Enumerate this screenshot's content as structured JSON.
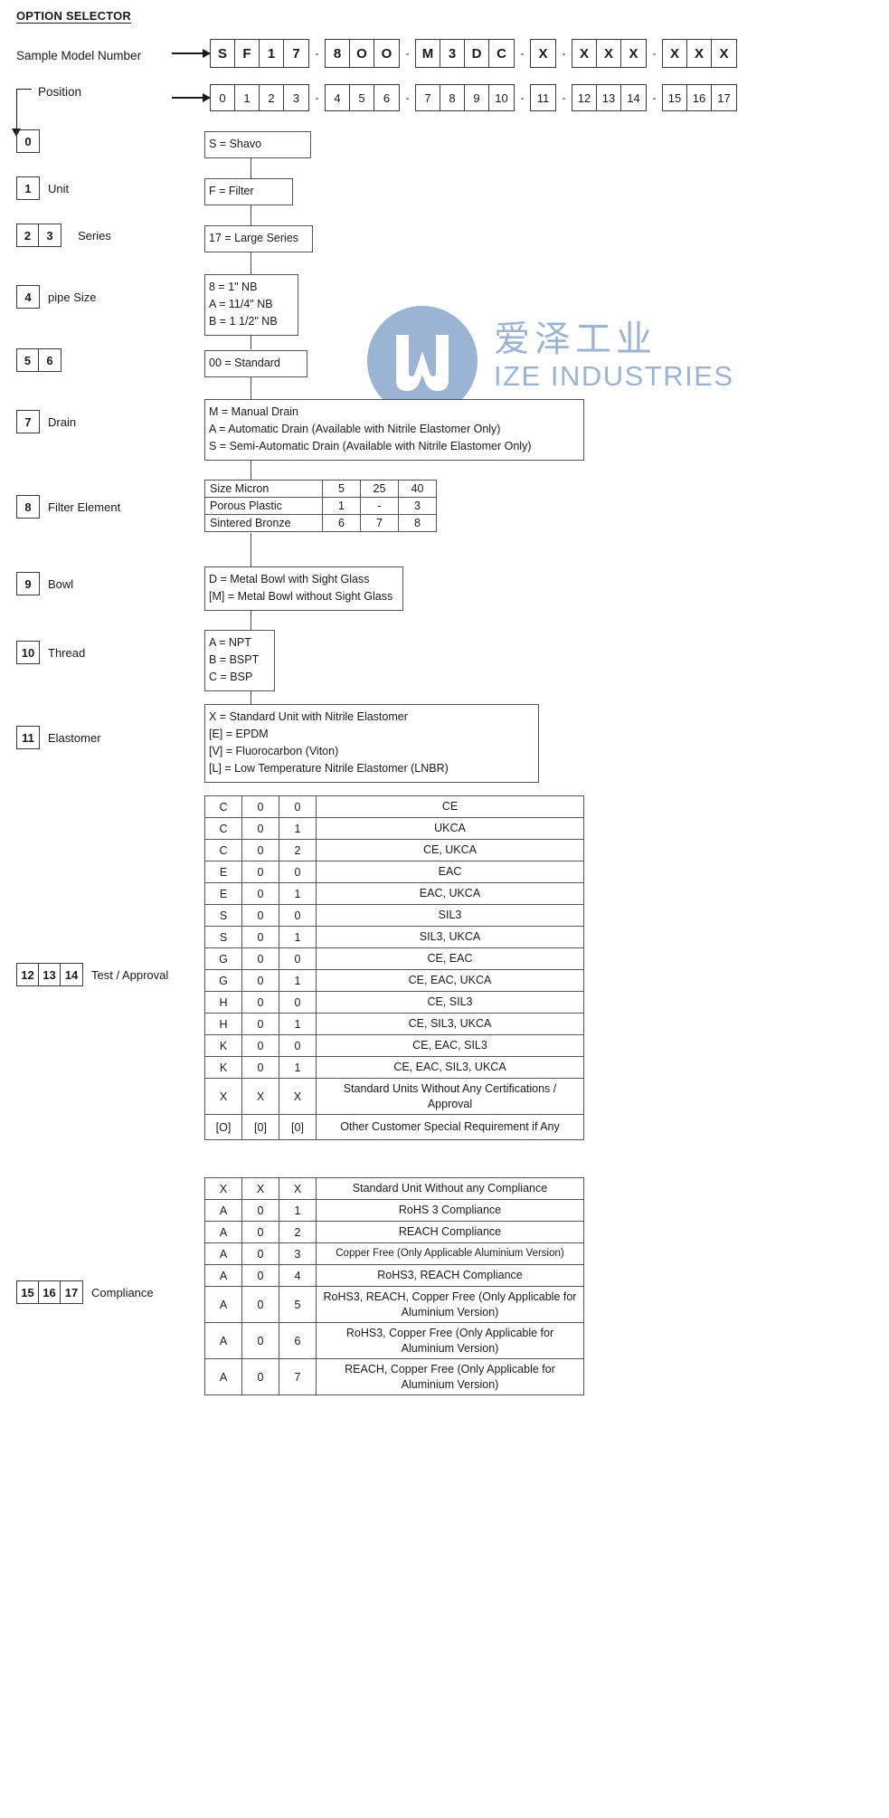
{
  "title": "OPTION SELECTOR",
  "header": {
    "sample_label": "Sample Model Number",
    "position_label": "Position",
    "model_groups": [
      [
        "S",
        "F",
        "1",
        "7"
      ],
      [
        "8",
        "O",
        "O"
      ],
      [
        "M",
        "3",
        "D",
        "C"
      ],
      [
        "X"
      ],
      [
        "X",
        "X",
        "X"
      ],
      [
        "X",
        "X",
        "X"
      ]
    ],
    "position_groups": [
      [
        "0",
        "1",
        "2",
        "3"
      ],
      [
        "4",
        "5",
        "6"
      ],
      [
        "7",
        "8",
        "9",
        "10"
      ],
      [
        "11"
      ],
      [
        "12",
        "13",
        "14"
      ],
      [
        "15",
        "16",
        "17"
      ]
    ],
    "separator": "-"
  },
  "watermark": {
    "chinese": "爱泽工业",
    "english": "IZE INDUSTRIES",
    "color": "#9bb4d4"
  },
  "sections": [
    {
      "keys": [
        "0"
      ],
      "label": "",
      "options": [
        "S = Shavo"
      ]
    },
    {
      "keys": [
        "1"
      ],
      "label": "Unit",
      "options": [
        "F = Filter"
      ]
    },
    {
      "keys": [
        "2",
        "3"
      ],
      "label": "Series",
      "options": [
        "17 = Large Series"
      ]
    },
    {
      "keys": [
        "4"
      ],
      "label": "pipe Size",
      "options": [
        "8 = 1\" NB",
        "A = 11/4\" NB",
        "B = 1 1/2\" NB"
      ]
    },
    {
      "keys": [
        "5",
        "6"
      ],
      "label": "",
      "options": [
        "00 = Standard"
      ]
    },
    {
      "keys": [
        "7"
      ],
      "label": "Drain",
      "options": [
        "M = Manual Drain",
        "A = Automatic Drain (Available with Nitrile Elastomer Only)",
        "S = Semi-Automatic Drain (Available with Nitrile Elastomer Only)"
      ]
    },
    {
      "keys": [
        "8"
      ],
      "label": "Filter Element",
      "options": []
    },
    {
      "keys": [
        "9"
      ],
      "label": "Bowl",
      "options": [
        "D = Metal Bowl with Sight Glass",
        "[M] = Metal Bowl without Sight Glass"
      ]
    },
    {
      "keys": [
        "10"
      ],
      "label": "Thread",
      "options": [
        "A = NPT",
        "B = BSPT",
        "C = BSP"
      ]
    },
    {
      "keys": [
        "11"
      ],
      "label": "Elastomer",
      "options": [
        "X = Standard Unit with Nitrile Elastomer",
        "[E] = EPDM",
        "[V] = Fluorocarbon (Viton)",
        "[L] = Low Temperature Nitrile Elastomer (LNBR)"
      ]
    },
    {
      "keys": [
        "12",
        "13",
        "14"
      ],
      "label": "Test / Approval",
      "options": []
    },
    {
      "keys": [
        "15",
        "16",
        "17"
      ],
      "label": "Compliance",
      "options": []
    }
  ],
  "filter_element_table": {
    "rows": [
      {
        "label": "Size Micron",
        "values": [
          "5",
          "25",
          "40"
        ]
      },
      {
        "label": "Porous Plastic",
        "values": [
          "1",
          "-",
          "3"
        ]
      },
      {
        "label": "Sintered Bronze",
        "values": [
          "6",
          "7",
          "8"
        ]
      }
    ]
  },
  "approval_table": {
    "rows": [
      {
        "c1": "C",
        "c2": "0",
        "c3": "0",
        "desc": "CE"
      },
      {
        "c1": "C",
        "c2": "0",
        "c3": "1",
        "desc": "UKCA"
      },
      {
        "c1": "C",
        "c2": "0",
        "c3": "2",
        "desc": "CE, UKCA"
      },
      {
        "c1": "E",
        "c2": "0",
        "c3": "0",
        "desc": "EAC"
      },
      {
        "c1": "E",
        "c2": "0",
        "c3": "1",
        "desc": "EAC, UKCA"
      },
      {
        "c1": "S",
        "c2": "0",
        "c3": "0",
        "desc": "SIL3"
      },
      {
        "c1": "S",
        "c2": "0",
        "c3": "1",
        "desc": "SIL3, UKCA"
      },
      {
        "c1": "G",
        "c2": "0",
        "c3": "0",
        "desc": "CE, EAC"
      },
      {
        "c1": "G",
        "c2": "0",
        "c3": "1",
        "desc": "CE, EAC, UKCA"
      },
      {
        "c1": "H",
        "c2": "0",
        "c3": "0",
        "desc": "CE, SIL3"
      },
      {
        "c1": "H",
        "c2": "0",
        "c3": "1",
        "desc": "CE, SIL3, UKCA"
      },
      {
        "c1": "K",
        "c2": "0",
        "c3": "0",
        "desc": "CE, EAC, SIL3"
      },
      {
        "c1": "K",
        "c2": "0",
        "c3": "1",
        "desc": "CE, EAC, SIL3, UKCA"
      },
      {
        "c1": "X",
        "c2": "X",
        "c3": "X",
        "desc": "Standard Units Without Any Certifications / Approval"
      },
      {
        "c1": "[O]",
        "c2": "[0]",
        "c3": "[0]",
        "desc": "Other Customer Special Requirement if Any"
      }
    ]
  },
  "compliance_table": {
    "rows": [
      {
        "c1": "X",
        "c2": "X",
        "c3": "X",
        "desc": "Standard Unit Without any Compliance"
      },
      {
        "c1": "A",
        "c2": "0",
        "c3": "1",
        "desc": "RoHS 3 Compliance"
      },
      {
        "c1": "A",
        "c2": "0",
        "c3": "2",
        "desc": "REACH Compliance"
      },
      {
        "c1": "A",
        "c2": "0",
        "c3": "3",
        "desc": "Copper Free (Only Applicable Aluminium Version)"
      },
      {
        "c1": "A",
        "c2": "0",
        "c3": "4",
        "desc": "RoHS3, REACH Compliance"
      },
      {
        "c1": "A",
        "c2": "0",
        "c3": "5",
        "desc": "RoHS3, REACH, Copper Free (Only Applicable for Aluminium Version)"
      },
      {
        "c1": "A",
        "c2": "0",
        "c3": "6",
        "desc": "RoHS3, Copper Free (Only Applicable for Aluminium Version)"
      },
      {
        "c1": "A",
        "c2": "0",
        "c3": "7",
        "desc": "REACH, Copper Free (Only Applicable for Aluminium Version)"
      }
    ]
  }
}
